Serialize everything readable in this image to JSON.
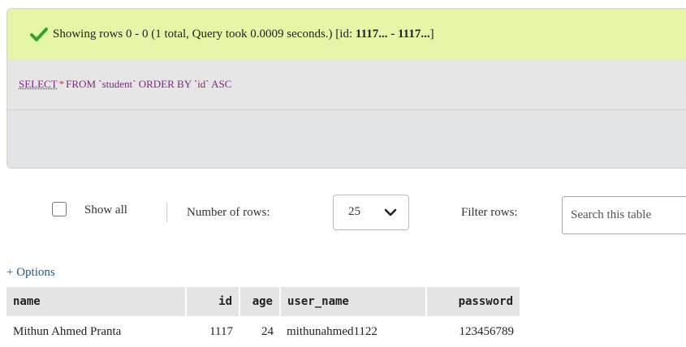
{
  "result": {
    "message_prefix": "Showing rows 0 - 0 (1 total, Query took 0.0009 seconds.) [id: ",
    "id_range": "1117... - 1117...",
    "message_suffix": "]",
    "sql_select": "SELECT",
    "sql_star": "*",
    "sql_rest": "FROM `student` ORDER BY `id` ASC"
  },
  "controls": {
    "show_all": "Show all",
    "number_of_rows_label": "Number of rows:",
    "number_of_rows_value": "25",
    "filter_rows_label": "Filter rows:",
    "search_placeholder": "Search this table"
  },
  "options_link": "+ Options",
  "table": {
    "headers": [
      "name",
      "id",
      "age",
      "user_name",
      "password"
    ],
    "rows": [
      [
        "Mithun Ahmed Pranta",
        "1117",
        "24",
        "mithunahmed1122",
        "123456789"
      ]
    ]
  },
  "colors": {
    "success_bg": "#e6f6a8",
    "sql_bg": "#e6e6e6",
    "link": "#235a81"
  }
}
